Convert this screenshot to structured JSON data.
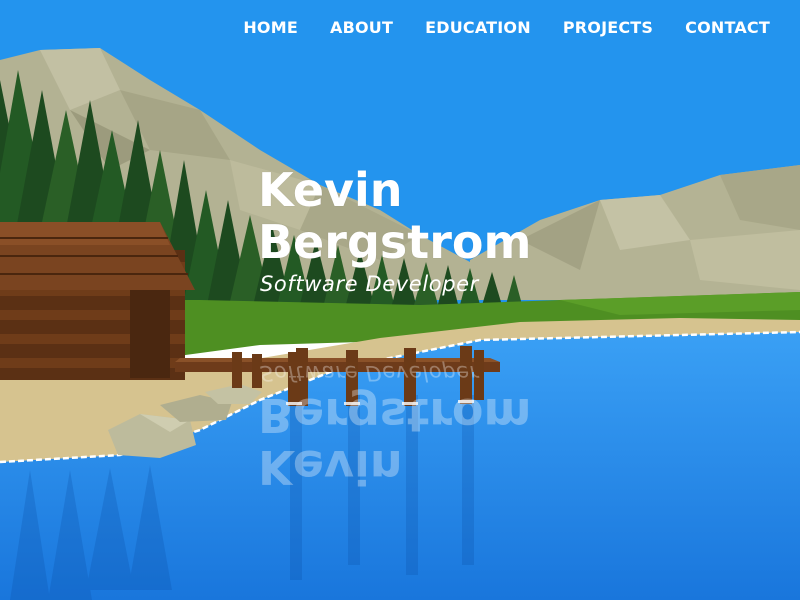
{
  "nav": {
    "items": [
      {
        "label": "HOME"
      },
      {
        "label": "ABOUT"
      },
      {
        "label": "EDUCATION"
      },
      {
        "label": "PROJECTS"
      },
      {
        "label": "CONTACT"
      }
    ]
  },
  "hero": {
    "first_name": "Kevin",
    "last_name": "Bergstrom",
    "subtitle": "Software Developer"
  },
  "colors": {
    "sky": "#2394ee",
    "mountain": "#b8b697",
    "forest": "#1f4a1f",
    "grass": "#4e8f22",
    "sand": "#d6c38f",
    "cabin": "#6b3a17",
    "lake": "#2c86e6",
    "text": "#ffffff"
  },
  "scene_icons": [
    "mountain-icon",
    "pine-tree-icon",
    "cabin-icon",
    "dock-icon",
    "lake-icon",
    "rock-icon"
  ]
}
